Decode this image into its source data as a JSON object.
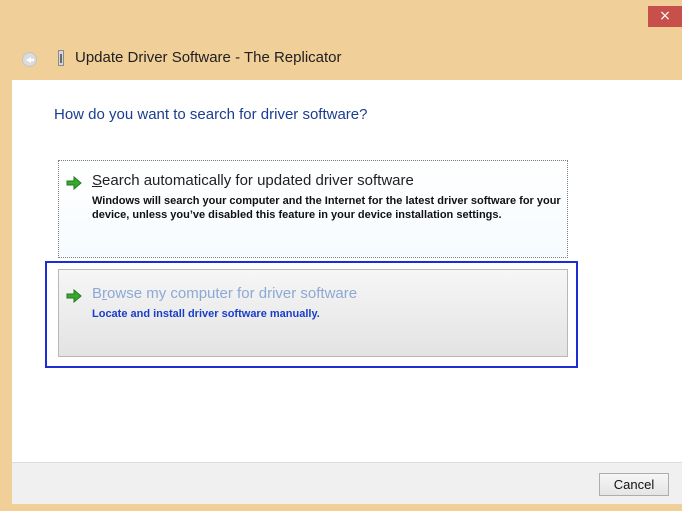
{
  "window": {
    "title": "Update Driver Software - The Replicator",
    "close_glyph": "×",
    "frame_color": "#f0cf99",
    "close_color": "#c7504a"
  },
  "main": {
    "question": "How do you want to search for driver software?",
    "options": [
      {
        "accel": "S",
        "title_rest": "earch automatically for updated driver software",
        "description": "Windows will search your computer and the Internet for the latest driver software for your device, unless you’ve disabled this feature in your device installation settings.",
        "icon": "green-arrow-icon"
      },
      {
        "title_pre": "B",
        "accel": "r",
        "title_rest": "owse my computer for driver software",
        "description": "Locate and install driver software manually.",
        "icon": "green-arrow-icon"
      }
    ]
  },
  "footer": {
    "cancel_label": "Cancel"
  },
  "colors": {
    "question_text": "#1a3e8f",
    "selection_border": "#1a2ed1",
    "browse_title": "#8ca9d4",
    "browse_desc": "#1a3ec8"
  }
}
